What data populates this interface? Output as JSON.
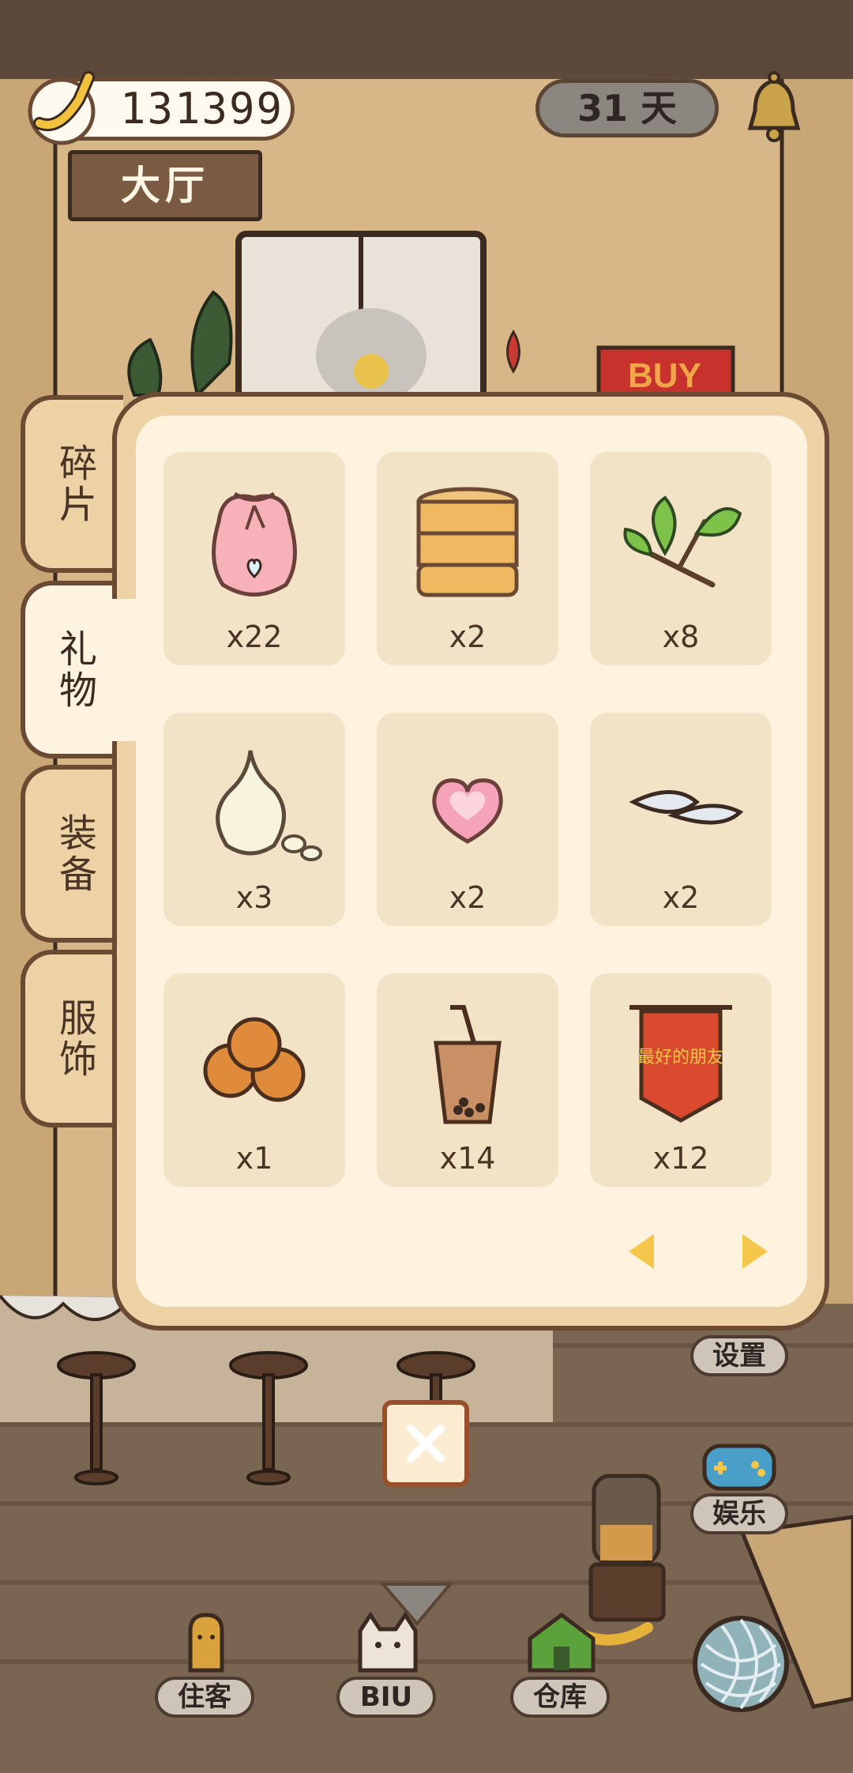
{
  "hud": {
    "coins": "131399",
    "days": "31 天",
    "room_name": "大厅"
  },
  "tabs": [
    {
      "label": "碎片",
      "active": false
    },
    {
      "label": "礼物",
      "active": true
    },
    {
      "label": "装备",
      "active": false
    },
    {
      "label": "服饰",
      "active": false
    }
  ],
  "items": [
    {
      "icon": "pink-pouch-icon",
      "count": "x22"
    },
    {
      "icon": "steamer-basket-icon",
      "count": "x2"
    },
    {
      "icon": "herb-sprig-icon",
      "count": "x8"
    },
    {
      "icon": "garlic-icon",
      "count": "x3"
    },
    {
      "icon": "heart-candy-icon",
      "count": "x2"
    },
    {
      "icon": "fish-bones-icon",
      "count": "x2"
    },
    {
      "icon": "bread-rolls-icon",
      "count": "x1"
    },
    {
      "icon": "bubble-tea-icon",
      "count": "x14"
    },
    {
      "icon": "red-banner-icon",
      "count": "x12"
    }
  ],
  "side_menu": {
    "settings_label": "设置",
    "entertainment_label": "娱乐"
  },
  "bottom_nav": {
    "residents_label": "住客",
    "biu_label": "BIU",
    "warehouse_label": "仓库"
  },
  "colors": {
    "panel_border": "#6b4a34",
    "panel_fill": "#ecd2a4",
    "panel_inner": "#fdf3df",
    "slot_fill": "#f2e2c6",
    "arrow": "#f4c64a"
  },
  "banner_text": "最好的朋友"
}
